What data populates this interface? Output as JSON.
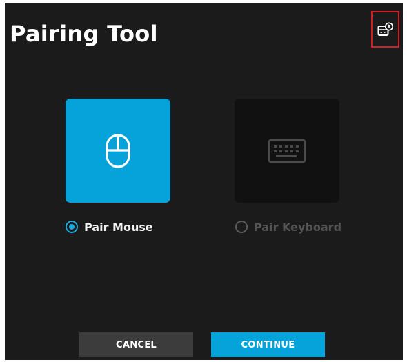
{
  "window": {
    "title": "Pairing Tool",
    "device_info_icon": "device-info-badge-icon"
  },
  "options": [
    {
      "id": "mouse",
      "label": "Pair Mouse",
      "icon": "mouse-icon",
      "selected": true
    },
    {
      "id": "keyboard",
      "label": "Pair Keyboard",
      "icon": "keyboard-icon",
      "selected": false
    }
  ],
  "buttons": {
    "cancel": "CANCEL",
    "continue": "CONTINUE"
  },
  "colors": {
    "background": "#1b1b1b",
    "accent": "#05a3d9",
    "highlight_border": "#d01f28",
    "secondary_button": "#3c3c3c",
    "disabled_text": "#545454"
  }
}
